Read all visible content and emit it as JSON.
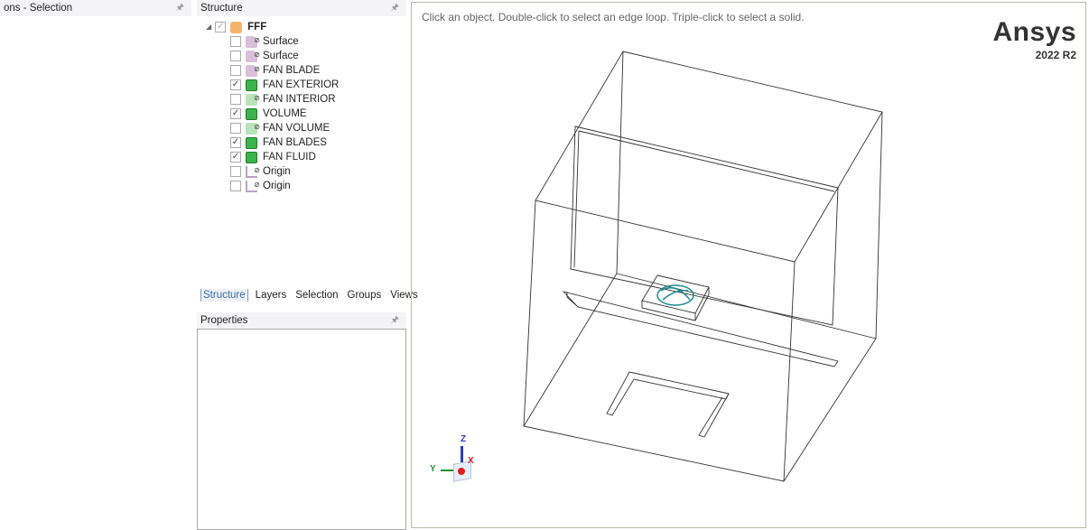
{
  "left_panel": {
    "title": "ons - Selection"
  },
  "structure": {
    "title": "Structure",
    "root": {
      "label": "FFF",
      "checked": true
    },
    "items": [
      {
        "label": "Surface",
        "checked": false,
        "icon": "surface-icon"
      },
      {
        "label": "Surface",
        "checked": false,
        "icon": "surface-icon"
      },
      {
        "label": "FAN BLADE",
        "checked": false,
        "icon": "surface-icon"
      },
      {
        "label": "FAN EXTERIOR",
        "checked": true,
        "icon": "solid-icon"
      },
      {
        "label": "FAN INTERIOR",
        "checked": false,
        "icon": "hidden-solid-icon"
      },
      {
        "label": "VOLUME",
        "checked": true,
        "icon": "solid-icon"
      },
      {
        "label": "FAN VOLUME",
        "checked": false,
        "icon": "hidden-solid-icon"
      },
      {
        "label": "FAN BLADES",
        "checked": true,
        "icon": "solid-icon"
      },
      {
        "label": "FAN FLUID",
        "checked": true,
        "icon": "solid-icon"
      },
      {
        "label": "Origin",
        "checked": false,
        "icon": "origin-icon"
      },
      {
        "label": "Origin",
        "checked": false,
        "icon": "origin-icon"
      }
    ]
  },
  "tabs": [
    "Structure",
    "Layers",
    "Selection",
    "Groups",
    "Views"
  ],
  "active_tab": "Structure",
  "properties": {
    "title": "Properties"
  },
  "viewport": {
    "hint": "Click an object. Double-click to select an edge loop. Triple-click to select a solid.",
    "brand": "Ansys",
    "version": "2022 R2",
    "axes": {
      "x": "X",
      "y": "Y",
      "z": "Z"
    }
  },
  "colors": {
    "accent": "#3a6ea5",
    "solid_green": "#3cb44b",
    "fan": "#1f8a8a"
  }
}
